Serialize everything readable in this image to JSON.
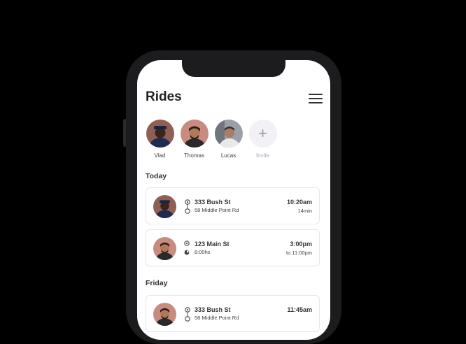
{
  "header": {
    "title": "Rides"
  },
  "contacts": [
    {
      "name": "Vlad"
    },
    {
      "name": "Thomas"
    },
    {
      "name": "Lucas"
    },
    {
      "name": "Invite"
    }
  ],
  "sections": [
    {
      "label": "Today"
    },
    {
      "label": "Friday"
    }
  ],
  "rides": [
    {
      "address": "333 Bush St",
      "sub": "58 Middle Point Rd",
      "time": "10:20am",
      "detail": "14min"
    },
    {
      "address": "123 Main St",
      "sub": "8:00hs",
      "time": "3:00pm",
      "detail": "to 11:00pm"
    },
    {
      "address": "333 Bush St",
      "sub": "58 Middle Point Rd",
      "time": "11:45am",
      "detail": ""
    }
  ],
  "icons": {
    "menu": "hamburger-icon",
    "invite": "plus-icon",
    "route": "route-icon",
    "pickup": "location-icon",
    "schedule": "clock-icon"
  }
}
